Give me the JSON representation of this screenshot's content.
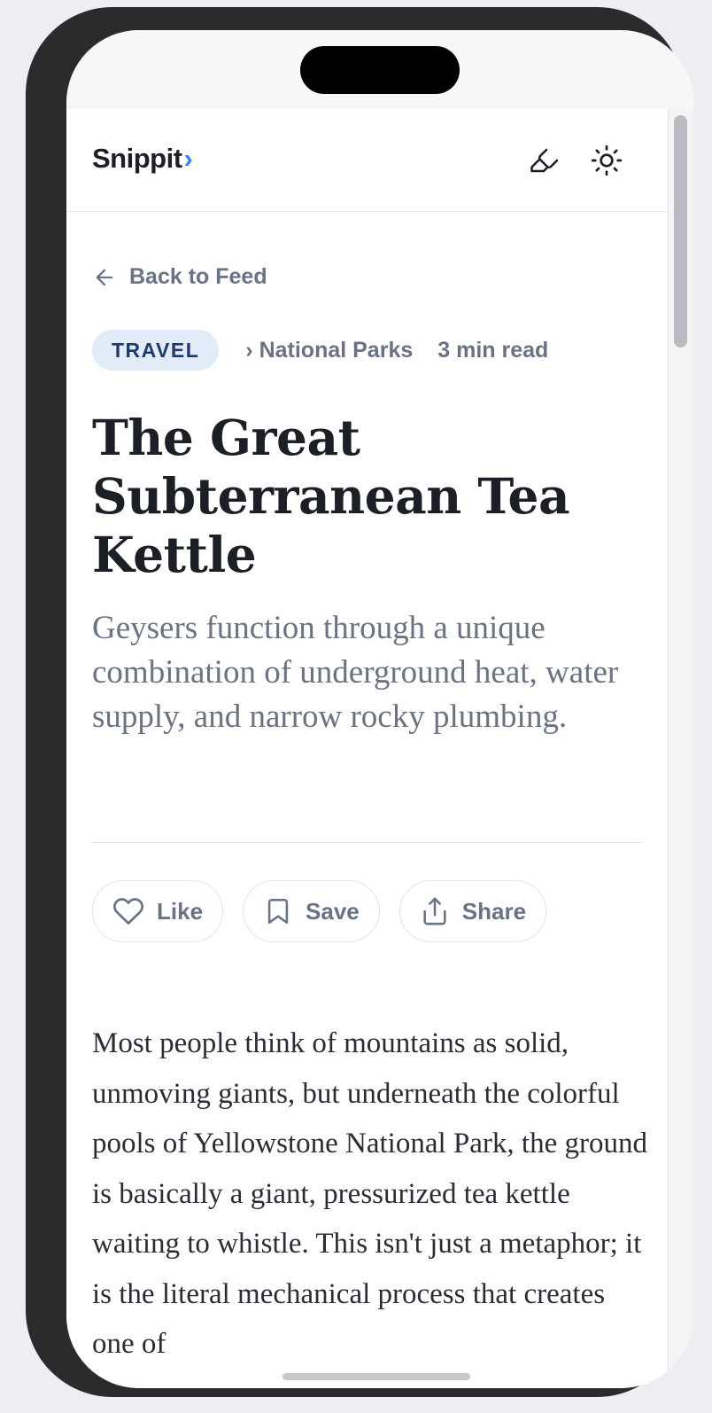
{
  "app": {
    "brand": "Snippit",
    "brand_mark": "›"
  },
  "header": {
    "highlighter_icon": "highlighter-icon",
    "theme_icon": "sun-icon"
  },
  "nav": {
    "back_label": "Back to Feed",
    "back_icon": "arrow-left-icon"
  },
  "article": {
    "category": "TRAVEL",
    "subcategory": "› National Parks",
    "read_time": "3 min read",
    "title": "The Great Subterranean Tea Kettle",
    "subtitle": "Geysers function through a unique combination of underground heat, water supply, and narrow rocky plumbing.",
    "body": "Most people think of mountains as solid, unmoving giants, but underneath the colorful pools of Yellowstone National Park, the ground is basically a giant, pressurized tea kettle waiting to whistle. This isn't just a metaphor; it is the literal mechanical process that creates one of"
  },
  "actions": {
    "like_label": "Like",
    "save_label": "Save",
    "share_label": "Share",
    "like_icon": "heart-icon",
    "save_icon": "bookmark-icon",
    "share_icon": "share-icon"
  },
  "colors": {
    "accent": "#3b82f6",
    "category_bg": "#e2ebf8",
    "category_text": "#1e3a68"
  }
}
